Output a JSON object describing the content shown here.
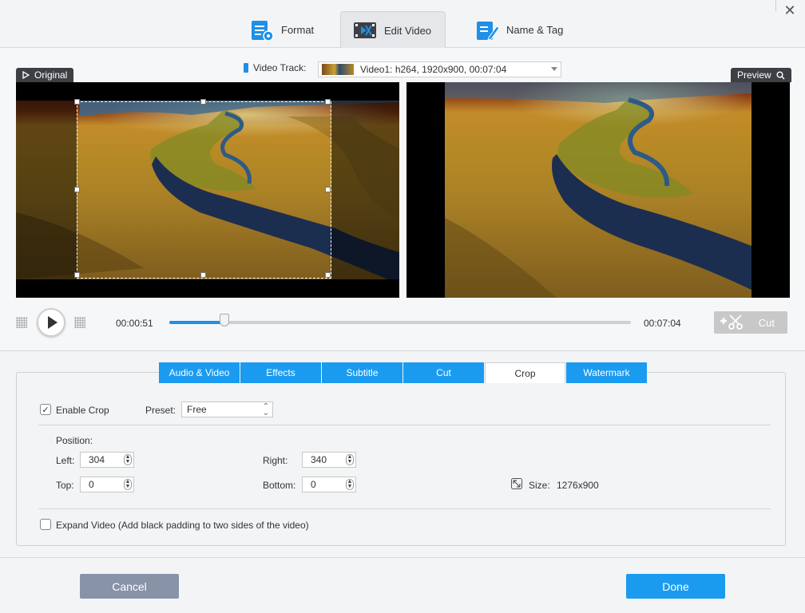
{
  "tabs": [
    {
      "label": "Format"
    },
    {
      "label": "Edit Video"
    },
    {
      "label": "Name & Tag"
    }
  ],
  "video_track": {
    "label": "Video Track:",
    "selected": "Video1: h264, 1920x900, 00:07:04"
  },
  "panes": {
    "original_label": "Original",
    "preview_label": "Preview"
  },
  "player": {
    "current_time": "00:00:51",
    "total_time": "00:07:04",
    "progress": 0.12,
    "cut_label": "Cut"
  },
  "edit_tabs": [
    "Audio & Video",
    "Effects",
    "Subtitle",
    "Cut",
    "Crop",
    "Watermark"
  ],
  "crop": {
    "enable_label": "Enable Crop",
    "enabled": true,
    "preset_label": "Preset:",
    "preset_value": "Free",
    "position_label": "Position:",
    "left_label": "Left:",
    "left_value": "304",
    "right_label": "Right:",
    "right_value": "340",
    "top_label": "Top:",
    "top_value": "0",
    "bottom_label": "Bottom:",
    "bottom_value": "0",
    "size_label": "Size:",
    "size_value": "1276x900",
    "expand_label": "Expand Video (Add black padding to two sides of the video)",
    "expand_checked": false
  },
  "footer": {
    "cancel_label": "Cancel",
    "done_label": "Done"
  },
  "colors": {
    "accent": "#1a9bf0",
    "cancel": "#8893a8",
    "done": "#1a9bf0"
  }
}
